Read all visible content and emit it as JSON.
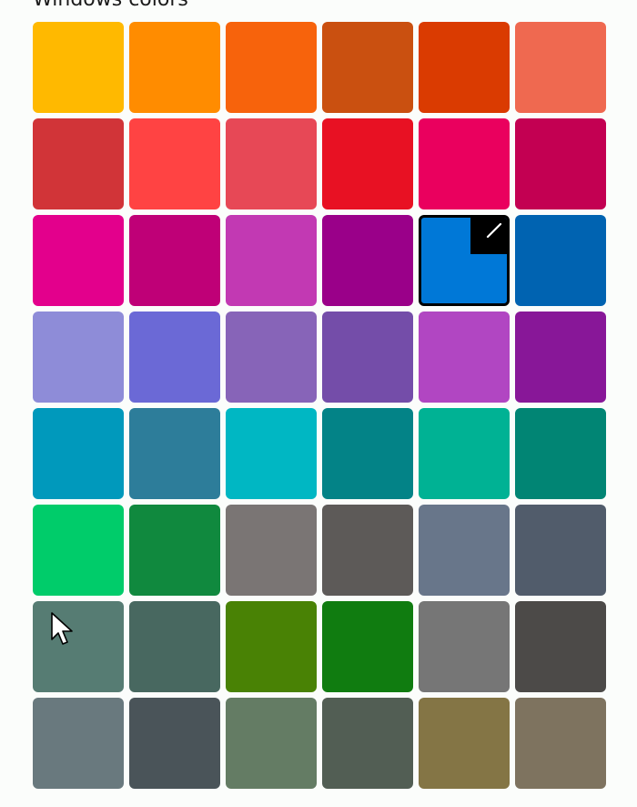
{
  "section": {
    "title": "Windows colors"
  },
  "swatches": [
    {
      "color": "#ffb900",
      "selected": false
    },
    {
      "color": "#ff8c00",
      "selected": false
    },
    {
      "color": "#f7630c",
      "selected": false
    },
    {
      "color": "#ca5010",
      "selected": false
    },
    {
      "color": "#da3b01",
      "selected": false
    },
    {
      "color": "#ef6950",
      "selected": false
    },
    {
      "color": "#d13438",
      "selected": false
    },
    {
      "color": "#ff4343",
      "selected": false
    },
    {
      "color": "#e74856",
      "selected": false
    },
    {
      "color": "#e81123",
      "selected": false
    },
    {
      "color": "#ea005e",
      "selected": false
    },
    {
      "color": "#c30052",
      "selected": false
    },
    {
      "color": "#e3008c",
      "selected": false
    },
    {
      "color": "#bf0077",
      "selected": false
    },
    {
      "color": "#c239b3",
      "selected": false
    },
    {
      "color": "#9a0089",
      "selected": false
    },
    {
      "color": "#0078d7",
      "selected": true
    },
    {
      "color": "#0063b1",
      "selected": false
    },
    {
      "color": "#8e8cd8",
      "selected": false
    },
    {
      "color": "#6b69d6",
      "selected": false
    },
    {
      "color": "#8764b8",
      "selected": false
    },
    {
      "color": "#744da9",
      "selected": false
    },
    {
      "color": "#b146c2",
      "selected": false
    },
    {
      "color": "#881798",
      "selected": false
    },
    {
      "color": "#0099bc",
      "selected": false
    },
    {
      "color": "#2d7d9a",
      "selected": false
    },
    {
      "color": "#00b7c3",
      "selected": false
    },
    {
      "color": "#038387",
      "selected": false
    },
    {
      "color": "#00b294",
      "selected": false
    },
    {
      "color": "#018574",
      "selected": false
    },
    {
      "color": "#00cc6a",
      "selected": false
    },
    {
      "color": "#10893e",
      "selected": false
    },
    {
      "color": "#7a7574",
      "selected": false
    },
    {
      "color": "#5d5a58",
      "selected": false
    },
    {
      "color": "#68768a",
      "selected": false
    },
    {
      "color": "#515c6b",
      "selected": false
    },
    {
      "color": "#567c73",
      "selected": false
    },
    {
      "color": "#486860",
      "selected": false
    },
    {
      "color": "#498205",
      "selected": false
    },
    {
      "color": "#107c10",
      "selected": false
    },
    {
      "color": "#767676",
      "selected": false
    },
    {
      "color": "#4c4a48",
      "selected": false
    },
    {
      "color": "#69797e",
      "selected": false
    },
    {
      "color": "#4a5459",
      "selected": false
    },
    {
      "color": "#647c64",
      "selected": false
    },
    {
      "color": "#525e54",
      "selected": false
    },
    {
      "color": "#847545",
      "selected": false
    },
    {
      "color": "#7e735f",
      "selected": false
    }
  ],
  "selected_indicator_icon": "checkmark-icon",
  "cursor_icon": "arrow-cursor-icon"
}
